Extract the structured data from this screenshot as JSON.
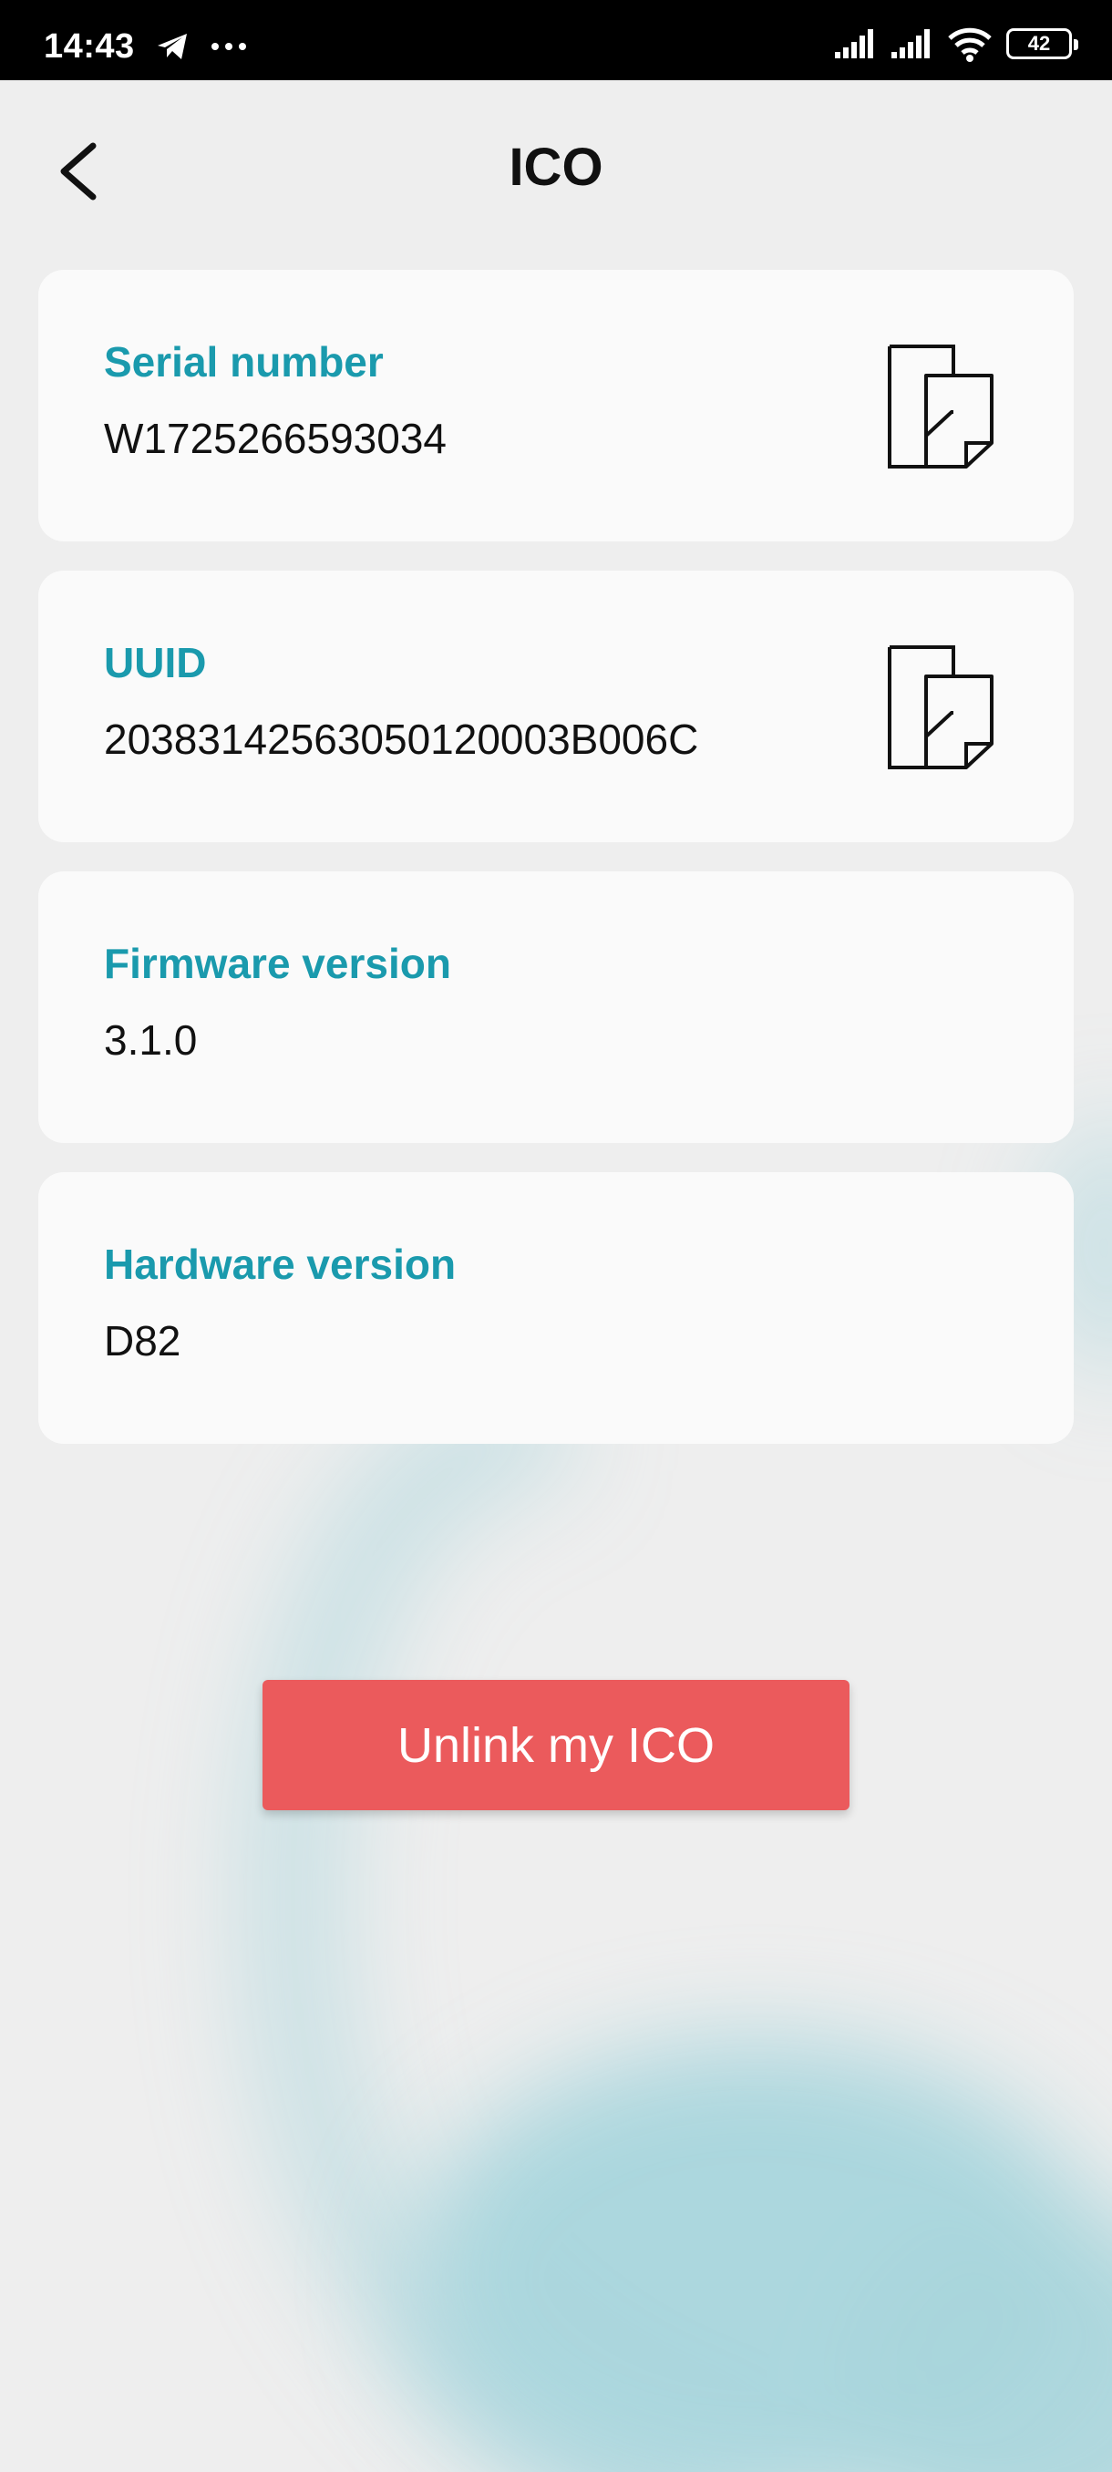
{
  "status_bar": {
    "time": "14:43",
    "battery": "42",
    "icons": [
      "telegram-icon",
      "more-dots-icon",
      "signal-icon",
      "signal-icon",
      "wifi-icon",
      "battery-icon"
    ]
  },
  "header": {
    "title": "ICO",
    "back_icon": "chevron-left-icon"
  },
  "cards": [
    {
      "label": "Serial number",
      "value": "W1725266593034",
      "copyable": true
    },
    {
      "label": "UUID",
      "value": "20383142563050120003B006C",
      "copyable": true
    },
    {
      "label": "Firmware version",
      "value": "3.1.0",
      "copyable": false
    },
    {
      "label": "Hardware version",
      "value": "D82",
      "copyable": false
    }
  ],
  "actions": {
    "unlink_label": "Unlink my ICO"
  },
  "colors": {
    "accent": "#1a9aad",
    "danger": "#eb5a5c",
    "background": "#eeeeee",
    "card": "#fafafa",
    "swirl": "#a8d5dc"
  }
}
